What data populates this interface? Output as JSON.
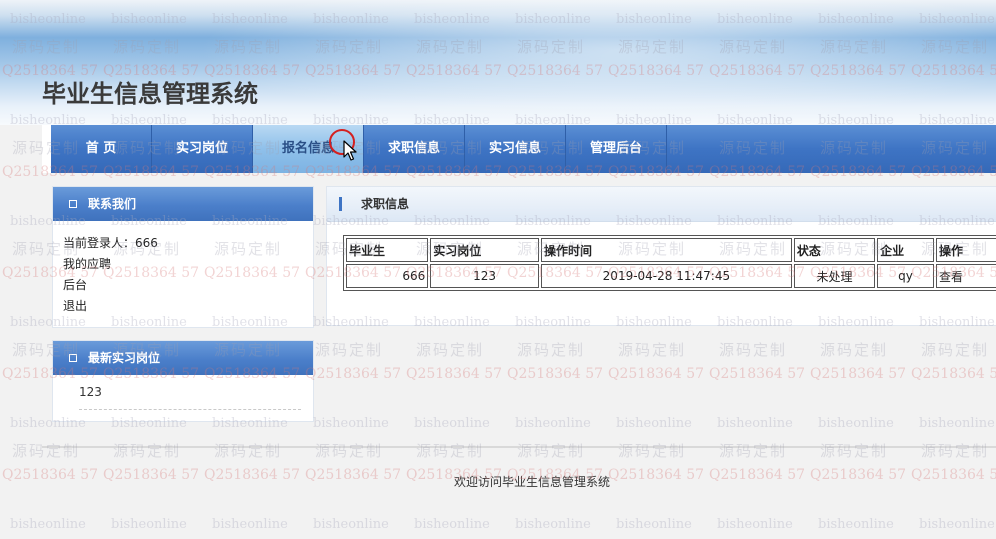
{
  "site": {
    "title": "毕业生信息管理系统"
  },
  "nav": {
    "items": [
      {
        "label": "首 页",
        "active": false
      },
      {
        "label": "实习岗位",
        "active": false
      },
      {
        "label": "报名信息",
        "active": true
      },
      {
        "label": "求职信息",
        "active": false
      },
      {
        "label": "实习信息",
        "active": false
      },
      {
        "label": "管理后台",
        "active": false
      }
    ]
  },
  "contact": {
    "title": "联系我们",
    "current_user": "当前登录人：666",
    "my_applications": "我的应聘",
    "backend": "后台",
    "logout": "退出"
  },
  "latest": {
    "title": "最新实习岗位",
    "items": [
      "123"
    ]
  },
  "content": {
    "title": "求职信息",
    "columns": [
      "毕业生",
      "实习岗位",
      "操作时间",
      "状态",
      "企业",
      "操作"
    ],
    "rows": [
      {
        "graduate": "666",
        "position": "123",
        "time": "2019-04-28 11:47:45",
        "status": "未处理",
        "company": "qy",
        "action": "查看"
      }
    ]
  },
  "footer": {
    "text": "欢迎访问毕业生信息管理系统"
  },
  "watermark": {
    "site": "bisheonline",
    "slogan": "源码定制",
    "qq": "Q2518364 57"
  },
  "colors": {
    "nav_blue": "#3e74c4",
    "nav_active": "#8fc0ea",
    "cursor_ring": "#d42020"
  },
  "icons": {
    "cursor": "mouse-pointer-icon",
    "bullet": "square-bullet-icon"
  }
}
